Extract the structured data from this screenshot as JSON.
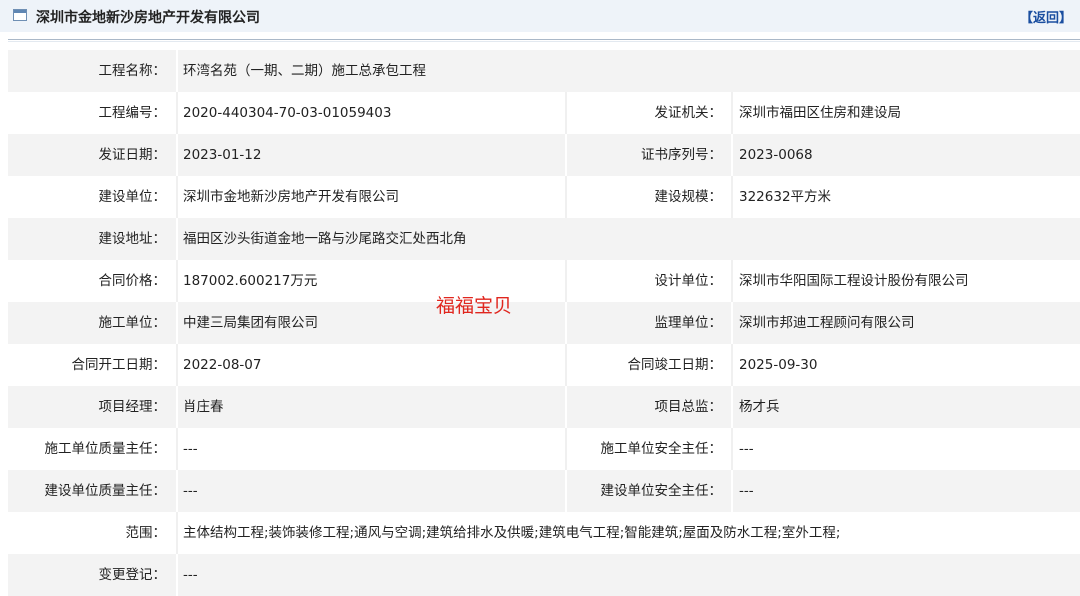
{
  "header": {
    "title": "深圳市金地新沙房地产开发有限公司",
    "back_label": "【返回】"
  },
  "rows": [
    {
      "label": "工程名称：",
      "value": "环湾名苑（一期、二期）施工总承包工程"
    },
    {
      "label": "工程编号：",
      "value": "2020-440304-70-03-01059403",
      "label2": "发证机关：",
      "value2": "深圳市福田区住房和建设局"
    },
    {
      "label": "发证日期：",
      "value": "2023-01-12",
      "label2": "证书序列号：",
      "value2": "2023-0068"
    },
    {
      "label": "建设单位：",
      "value": "深圳市金地新沙房地产开发有限公司",
      "label2": "建设规模：",
      "value2": "322632平方米"
    },
    {
      "label": "建设地址：",
      "value": "福田区沙头街道金地一路与沙尾路交汇处西北角"
    },
    {
      "label": "合同价格：",
      "value": "187002.600217万元",
      "label2": "设计单位：",
      "value2": "深圳市华阳国际工程设计股份有限公司"
    },
    {
      "label": "施工单位：",
      "value": "中建三局集团有限公司",
      "label2": "监理单位：",
      "value2": "深圳市邦迪工程顾问有限公司"
    },
    {
      "label": "合同开工日期：",
      "value": "2022-08-07",
      "label2": "合同竣工日期：",
      "value2": "2025-09-30"
    },
    {
      "label": "项目经理：",
      "value": "肖庄春",
      "label2": "项目总监：",
      "value2": "杨才兵"
    },
    {
      "label": "施工单位质量主任：",
      "value": "---",
      "label2": "施工单位安全主任：",
      "value2": "---"
    },
    {
      "label": "建设单位质量主任：",
      "value": "---",
      "label2": "建设单位安全主任：",
      "value2": "---"
    },
    {
      "label": "范围：",
      "value": "主体结构工程;装饰装修工程;通风与空调;建筑给排水及供暖;建筑电气工程;智能建筑;屋面及防水工程;室外工程;"
    },
    {
      "label": "变更登记：",
      "value": "---"
    }
  ],
  "watermark": "福福宝贝"
}
